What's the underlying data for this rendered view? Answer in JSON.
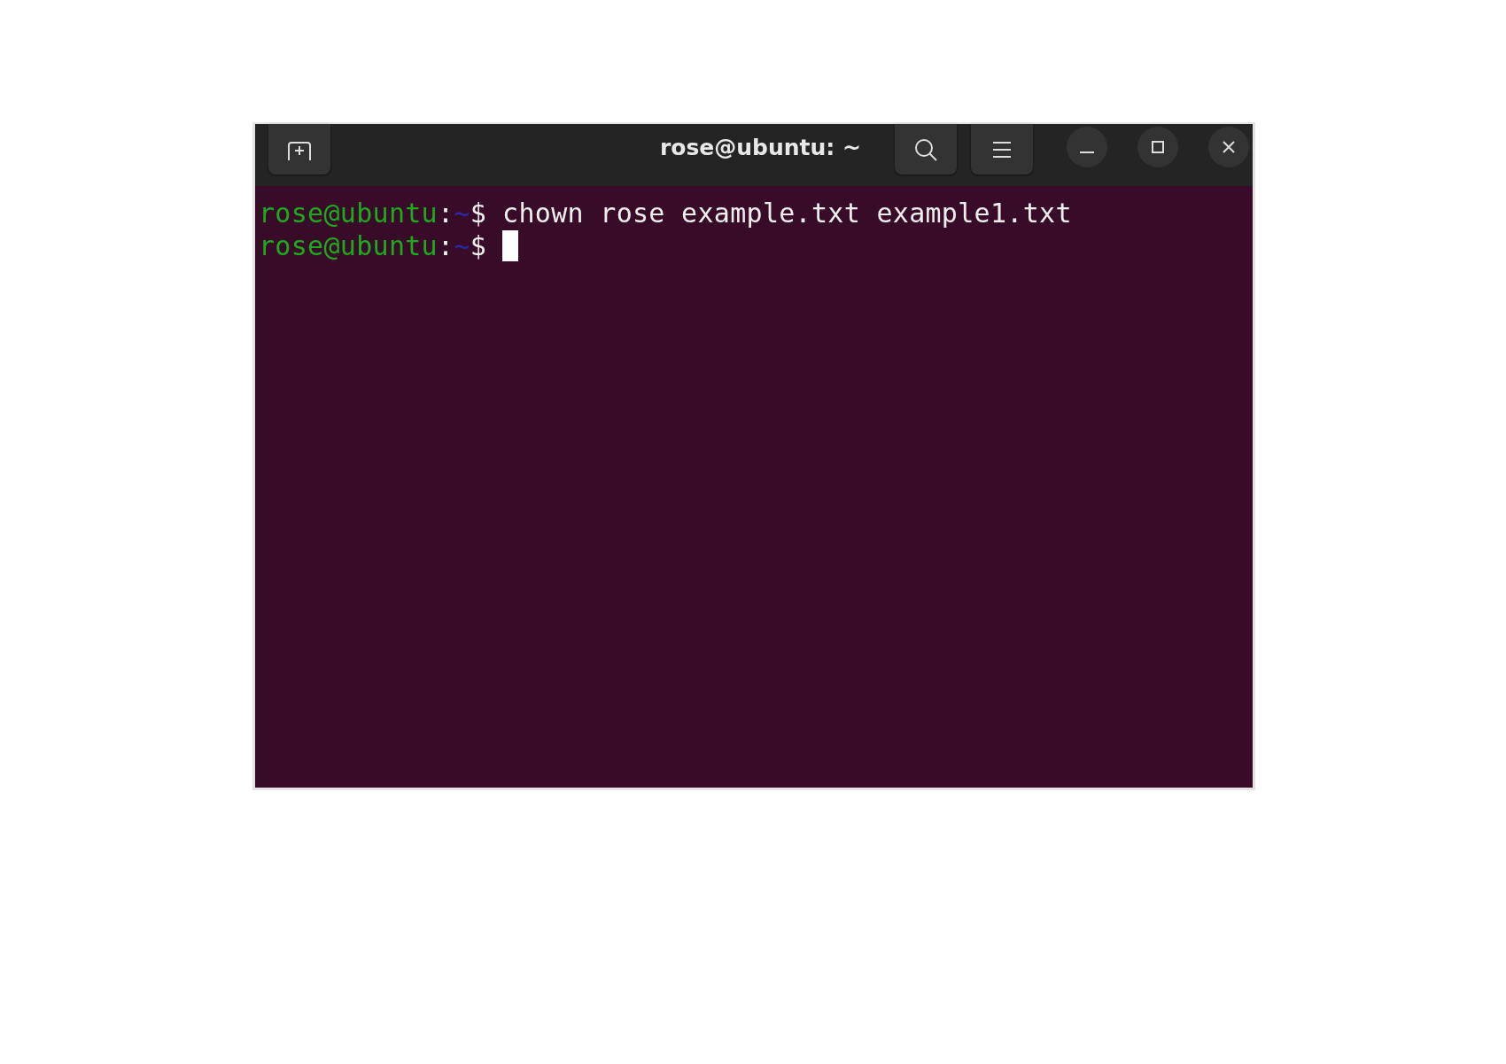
{
  "window": {
    "title": "rose@ubuntu: ~"
  },
  "terminal": {
    "lines": [
      {
        "user": "rose@ubuntu",
        "separator": ":",
        "path": "~",
        "symbol": "$",
        "command": "chown rose example.txt example1.txt",
        "cursor": false
      },
      {
        "user": "rose@ubuntu",
        "separator": ":",
        "path": "~",
        "symbol": "$",
        "cursor": true
      }
    ]
  }
}
